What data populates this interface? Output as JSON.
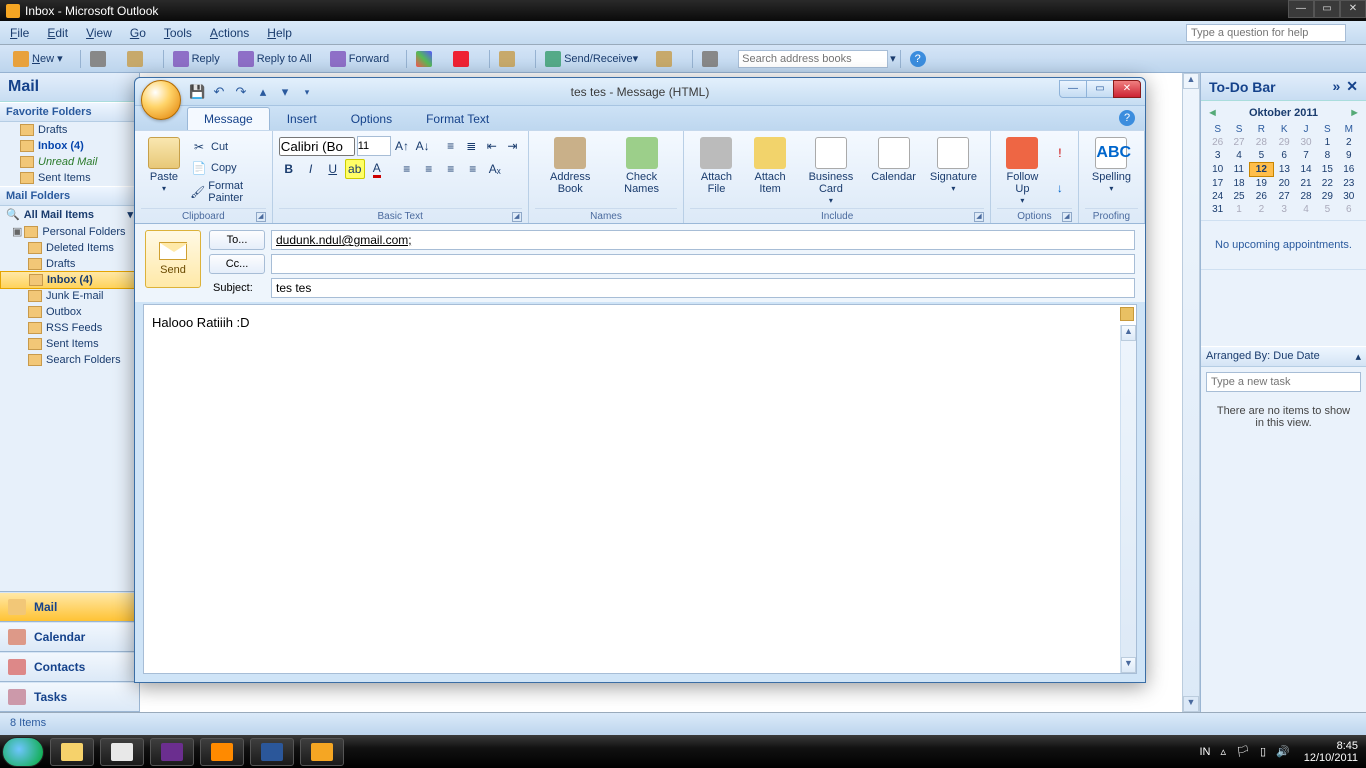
{
  "parent_window": {
    "title": "Inbox - Microsoft Outlook"
  },
  "menu": {
    "file": "File",
    "edit": "Edit",
    "view": "View",
    "go": "Go",
    "tools": "Tools",
    "actions": "Actions",
    "help": "Help"
  },
  "help_box": {
    "placeholder": "Type a question for help"
  },
  "toolbar": {
    "new": "New",
    "reply": "Reply",
    "reply_all": "Reply to All",
    "forward": "Forward",
    "send_receive": "Send/Receive",
    "search_books_placeholder": "Search address books"
  },
  "leftnav": {
    "mail": "Mail",
    "fav_hdr": "Favorite Folders",
    "fav": [
      {
        "label": "Drafts",
        "icon": "drafts-icon"
      },
      {
        "label": "Inbox (4)",
        "icon": "inbox-icon",
        "bold": true
      },
      {
        "label": "Unread Mail",
        "icon": "unread-icon",
        "italic": true
      },
      {
        "label": "Sent Items",
        "icon": "sent-icon"
      }
    ],
    "folders_hdr": "Mail Folders",
    "all_items": "All Mail Items",
    "tree": [
      {
        "label": "Personal Folders",
        "icon": "pf-icon"
      },
      {
        "label": "Deleted Items",
        "icon": "deleted-icon"
      },
      {
        "label": "Drafts",
        "icon": "drafts-icon"
      },
      {
        "label": "Inbox  (4)",
        "icon": "inbox-icon",
        "selected": true
      },
      {
        "label": "Junk E-mail",
        "icon": "junk-icon"
      },
      {
        "label": "Outbox",
        "icon": "outbox-icon"
      },
      {
        "label": "RSS Feeds",
        "icon": "rss-icon"
      },
      {
        "label": "Sent Items",
        "icon": "sent-icon"
      },
      {
        "label": "Search Folders",
        "icon": "search-folder-icon"
      }
    ],
    "big": [
      {
        "label": "Mail",
        "icon": "mail-icon",
        "active": true
      },
      {
        "label": "Calendar",
        "icon": "calendar-icon"
      },
      {
        "label": "Contacts",
        "icon": "contacts-icon"
      },
      {
        "label": "Tasks",
        "icon": "tasks-icon"
      }
    ]
  },
  "status": {
    "items": "8 Items"
  },
  "todo": {
    "title": "To-Do Bar",
    "month": "Oktober 2011",
    "dow": [
      "S",
      "S",
      "R",
      "K",
      "J",
      "S",
      "M"
    ],
    "weeks": [
      [
        {
          "d": "26",
          "dim": true
        },
        {
          "d": "27",
          "dim": true
        },
        {
          "d": "28",
          "dim": true
        },
        {
          "d": "29",
          "dim": true
        },
        {
          "d": "30",
          "dim": true
        },
        {
          "d": "1"
        },
        {
          "d": "2"
        }
      ],
      [
        {
          "d": "3"
        },
        {
          "d": "4"
        },
        {
          "d": "5"
        },
        {
          "d": "6"
        },
        {
          "d": "7"
        },
        {
          "d": "8"
        },
        {
          "d": "9"
        }
      ],
      [
        {
          "d": "10"
        },
        {
          "d": "11"
        },
        {
          "d": "12",
          "today": true
        },
        {
          "d": "13"
        },
        {
          "d": "14"
        },
        {
          "d": "15"
        },
        {
          "d": "16"
        }
      ],
      [
        {
          "d": "17"
        },
        {
          "d": "18"
        },
        {
          "d": "19"
        },
        {
          "d": "20"
        },
        {
          "d": "21"
        },
        {
          "d": "22"
        },
        {
          "d": "23"
        }
      ],
      [
        {
          "d": "24"
        },
        {
          "d": "25"
        },
        {
          "d": "26"
        },
        {
          "d": "27"
        },
        {
          "d": "28"
        },
        {
          "d": "29"
        },
        {
          "d": "30"
        }
      ],
      [
        {
          "d": "31"
        },
        {
          "d": "1",
          "dim": true
        },
        {
          "d": "2",
          "dim": true
        },
        {
          "d": "3",
          "dim": true
        },
        {
          "d": "4",
          "dim": true
        },
        {
          "d": "5",
          "dim": true
        },
        {
          "d": "6",
          "dim": true
        }
      ]
    ],
    "no_appointments": "No upcoming appointments.",
    "arranged_by": "Arranged By: Due Date",
    "new_task_placeholder": "Type a new task",
    "no_items": "There are no items to show in this view."
  },
  "compose": {
    "title": "tes tes - Message (HTML)",
    "tabs": {
      "message": "Message",
      "insert": "Insert",
      "options": "Options",
      "format": "Format Text"
    },
    "ribbon": {
      "paste": "Paste",
      "cut": "Cut",
      "copy": "Copy",
      "format_painter": "Format Painter",
      "clipboard": "Clipboard",
      "font": "Calibri (Bo",
      "size": "11",
      "basic_text": "Basic Text",
      "address_book": "Address Book",
      "check_names": "Check Names",
      "names": "Names",
      "attach_file": "Attach File",
      "attach_item": "Attach Item",
      "business_card": "Business Card",
      "calendar": "Calendar",
      "signature": "Signature",
      "include": "Include",
      "follow_up": "Follow Up",
      "options": "Options",
      "spelling": "Spelling",
      "proofing": "Proofing"
    },
    "fields": {
      "send": "Send",
      "to_btn": "To...",
      "cc_btn": "Cc...",
      "subject_lbl": "Subject:",
      "to_value": "dudunk.ndul@gmail.com;",
      "cc_value": "",
      "subject_value": "tes tes"
    },
    "body": "Halooo Ratiiih :D"
  },
  "taskbar": {
    "lang": "IN",
    "time": "8:45",
    "date": "12/10/2011",
    "pins": [
      {
        "name": "explorer-icon",
        "color": "#f6d26b"
      },
      {
        "name": "chrome-icon",
        "color": "#e8e8e8"
      },
      {
        "name": "yahoo-icon",
        "color": "#6b2e8f"
      },
      {
        "name": "media-icon",
        "color": "#ff8a00"
      },
      {
        "name": "word-icon",
        "color": "#2b579a"
      },
      {
        "name": "outlook-icon",
        "color": "#f5a623"
      }
    ]
  }
}
